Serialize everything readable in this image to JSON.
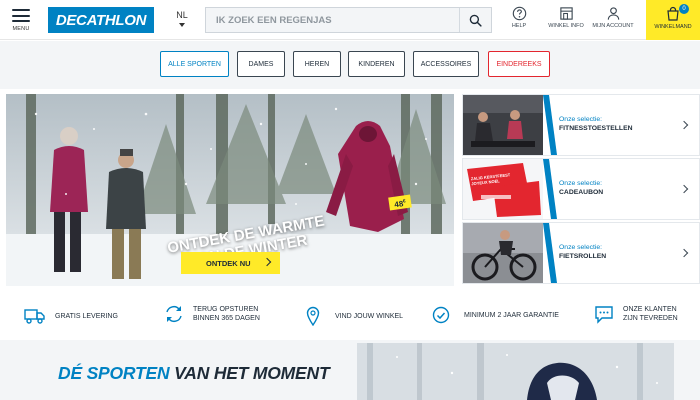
{
  "header": {
    "menu_label": "MENU",
    "logo_text": "DECATHLON",
    "language": "NL",
    "search_placeholder": "IK ZOEK EEN REGENJAS",
    "help_label": "HELP",
    "store_info_label": "WINKEL INFO",
    "account_label": "MIJN ACCOUNT",
    "cart_label": "WINKELMAND",
    "cart_count": "0"
  },
  "categories": [
    {
      "label": "ALLE SPORTEN"
    },
    {
      "label": "DAMES"
    },
    {
      "label": "HEREN"
    },
    {
      "label": "KINDEREN"
    },
    {
      "label": "ACCESSOIRES"
    },
    {
      "label": "EINDEREEKS"
    }
  ],
  "hero": {
    "title": "ONTDEK DE WARMTE VAN DE WINTER",
    "cta_label": "ONTDEK NU",
    "price": "48",
    "price_symbol": "€"
  },
  "promos": [
    {
      "line1": "Onze selectie:",
      "line2": "FITNESSTOESTELLEN"
    },
    {
      "line1": "Onze selectie:",
      "line2": "CADEAUBON",
      "card_text": "ZALIG KERSTFEEST JOYEUX NOËL"
    },
    {
      "line1": "Onze selectie:",
      "line2": "FIETSROLLEN"
    }
  ],
  "features": [
    {
      "icon": "truck-icon",
      "text": "GRATIS LEVERING"
    },
    {
      "icon": "return-arrows-icon",
      "text": "TERUG OPSTUREN\nBINNEN 365 DAGEN"
    },
    {
      "icon": "map-pin-icon",
      "text": "VIND JOUW WINKEL"
    },
    {
      "icon": "check-circle-icon",
      "text": "MINIMUM 2 JAAR GARANTIE"
    },
    {
      "icon": "chat-bubble-icon",
      "text": "ONZE KLANTEN\nZIJN TEVREDEN"
    }
  ],
  "sports_section": {
    "title_accent": "DÉ SPORTEN",
    "title_rest": " VAN HET MOMENT"
  },
  "colors": {
    "brand_blue": "#0082c3",
    "cta_yellow": "#ffea28",
    "sale_red": "#e3262f",
    "text_dark": "#1e2b38"
  }
}
